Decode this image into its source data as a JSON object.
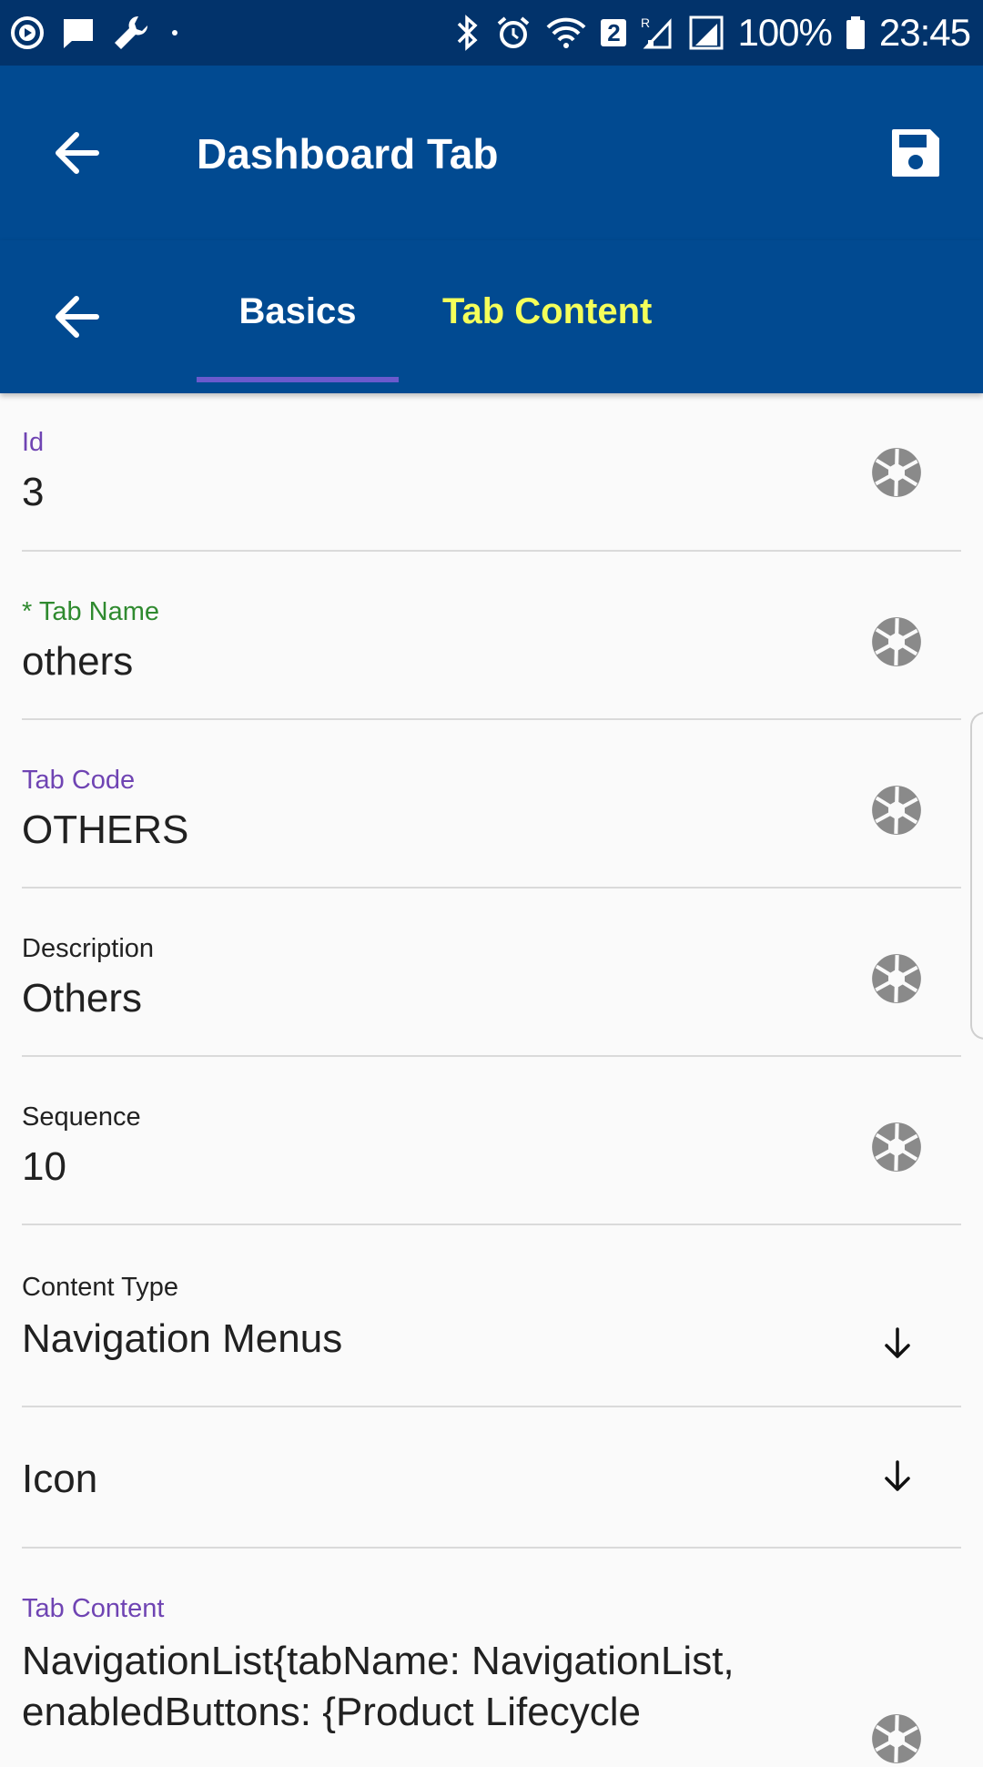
{
  "status_bar": {
    "battery": "100%",
    "time": "23:45",
    "sim_badge": "2",
    "icons": [
      "play-circle-icon",
      "message-icon",
      "wrench-icon",
      "dot-icon",
      "bluetooth-icon",
      "alarm-icon",
      "wifi-icon",
      "roaming-signal-icon",
      "signal-icon",
      "battery-icon"
    ]
  },
  "app_bar": {
    "title": "Dashboard Tab",
    "back_icon": "arrow-back-icon",
    "save_icon": "save-icon"
  },
  "tabs": {
    "back_icon": "arrow-back-icon",
    "items": [
      {
        "label": "Basics",
        "active": true
      },
      {
        "label": "Tab Content",
        "active": false
      }
    ],
    "active_color": "#ffffff",
    "inactive_color": "#f4ff5a"
  },
  "fields": [
    {
      "label": "Id",
      "value": "3",
      "icon": "shutter-icon"
    },
    {
      "label": "* Tab Name",
      "value": "others",
      "icon": "shutter-icon"
    },
    {
      "label": "Tab Code",
      "value": "OTHERS",
      "icon": "shutter-icon"
    },
    {
      "label": "Description",
      "value": "Others",
      "icon": "shutter-icon"
    },
    {
      "label": "Sequence",
      "value": "10",
      "icon": "shutter-icon"
    },
    {
      "label": "Content Type",
      "value": "Navigation Menus",
      "icon": "arrow-down-icon"
    },
    {
      "label": "",
      "value": "Icon",
      "icon": "arrow-down-icon"
    },
    {
      "label": "Tab Content",
      "value_lines": [
        "NavigationList{tabName: NavigationList,",
        "enabledButtons: {Product Lifecycle"
      ],
      "icon": "shutter-icon"
    }
  ],
  "colors": {
    "status_bar": "#02336b",
    "app_bar": "#014a91",
    "label_purple": "#6f44b3",
    "label_green": "#2f8a2f",
    "icon_gray": "#8a8a8a"
  }
}
